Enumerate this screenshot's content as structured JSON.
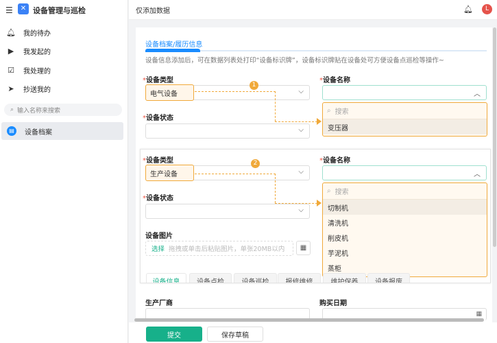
{
  "app": {
    "title": "设备管理与巡检"
  },
  "sidebar": {
    "items": [
      {
        "label": "我的待办",
        "icon": "bell-icon"
      },
      {
        "label": "我发起的",
        "icon": "play-icon"
      },
      {
        "label": "我处理的",
        "icon": "inbox-check-icon"
      },
      {
        "label": "抄送我的",
        "icon": "send-icon"
      }
    ],
    "search_placeholder": "输入名称来搜索",
    "active_item": "设备档案"
  },
  "header": {
    "title": "仅添加数据",
    "avatar": "L"
  },
  "form": {
    "section_title": "设备档案/履历信息",
    "hint": "设备信息添加后，可在数据列表处打印“设备标识牌”，设备标识牌贴在设备处可方便设备点巡检等操作~",
    "type_label": "设备类型",
    "name_label": "设备名称",
    "status_label": "设备状态",
    "step1": {
      "badge": "1",
      "type_value": "电气设备",
      "search_placeholder": "搜索",
      "options": [
        "变压器"
      ]
    },
    "step2": {
      "badge": "2",
      "type_value": "生产设备",
      "search_placeholder": "搜索",
      "options": [
        "切制机",
        "清洗机",
        "削皮机",
        "芋泥机",
        "蒸柜"
      ]
    },
    "image_label": "设备图片",
    "upload_select": "选择",
    "upload_hint": "拖拽或单击后粘贴图片，单张20MB以内",
    "tabs": [
      "设备信息",
      "设备点检",
      "设备巡检",
      "报修维修",
      "维护保养",
      "设备报废"
    ],
    "maker_label": "生产厂商",
    "date_label": "购买日期"
  },
  "actions": {
    "submit": "提交",
    "draft": "保存草稿"
  },
  "colors": {
    "accent": "#1a8cff",
    "primary": "#17b08a",
    "highlight": "#f0a93a"
  }
}
